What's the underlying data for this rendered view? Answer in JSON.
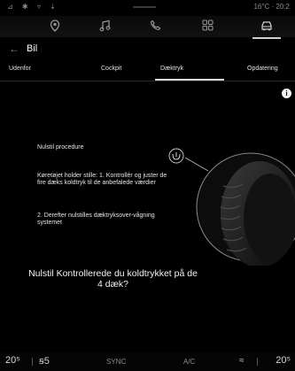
{
  "status_bar": {
    "left_icons": "⊿ ✱ ▿ ⇣",
    "temp_time": "16°C · 20:2"
  },
  "nav": {
    "icons": [
      "location-pin-icon",
      "music-note-icon",
      "phone-icon",
      "apps-grid-icon",
      "car-icon"
    ]
  },
  "header": {
    "back": "←",
    "title": "Bil"
  },
  "tabs": [
    {
      "label": "Udenfor"
    },
    {
      "label": "Cockpit"
    },
    {
      "label": "Dæktryk"
    },
    {
      "label": "Opdatering"
    }
  ],
  "active_tab": "Dæktryk",
  "info_icon": "i",
  "procedure": {
    "heading": "Nulstil procedure",
    "step1": "Køretøjet holder stille: 1. Kontrollér og juster de fire dæks koldtryk til de anbefalede værdier",
    "step2": "2. Derefter nulstilles dæktryksover-vågning systemet"
  },
  "reset_question": "Nulstil Kontrollerede du koldtrykket på de 4 dæk?",
  "bottom_bar": {
    "temp_left": "20⁵",
    "fan": "ꞩ5",
    "sync": "SYNC",
    "ac": "A/C",
    "temp_right": "20⁵"
  }
}
